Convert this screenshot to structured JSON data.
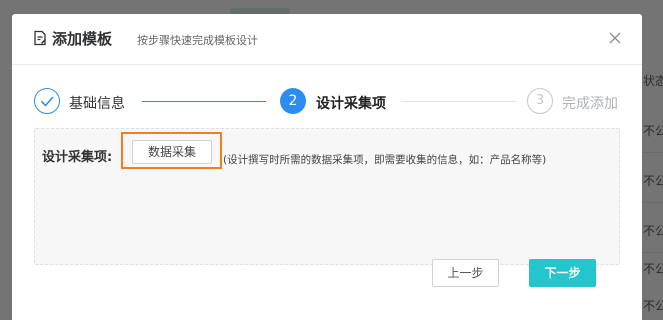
{
  "background": {
    "column_header": "状态",
    "cells": [
      "不公",
      "不公",
      "不公",
      "不公",
      "不公"
    ]
  },
  "dialog": {
    "title": "添加模板",
    "subtitle": "按步骤快速完成模板设计",
    "title_icon": "document-edit-icon",
    "close_icon": "close-icon"
  },
  "steps": [
    {
      "number": "1",
      "label": "基础信息",
      "status": "finished",
      "icon": "check-icon"
    },
    {
      "number": "2",
      "label": "设计采集项",
      "status": "active"
    },
    {
      "number": "3",
      "label": "完成添加",
      "status": "waiting"
    }
  ],
  "form": {
    "field_label": "设计采集项:",
    "collect_button": "数据采集",
    "hint": "(设计撰写时所需的数据采集项，即需要收集的信息，如：产品名称等)"
  },
  "footer": {
    "prev_label": "上一步",
    "next_label": "下一步"
  },
  "colors": {
    "accent_blue": "#2d8cf0",
    "next_button": "#24c5cc",
    "highlight_border": "#f57f17"
  }
}
